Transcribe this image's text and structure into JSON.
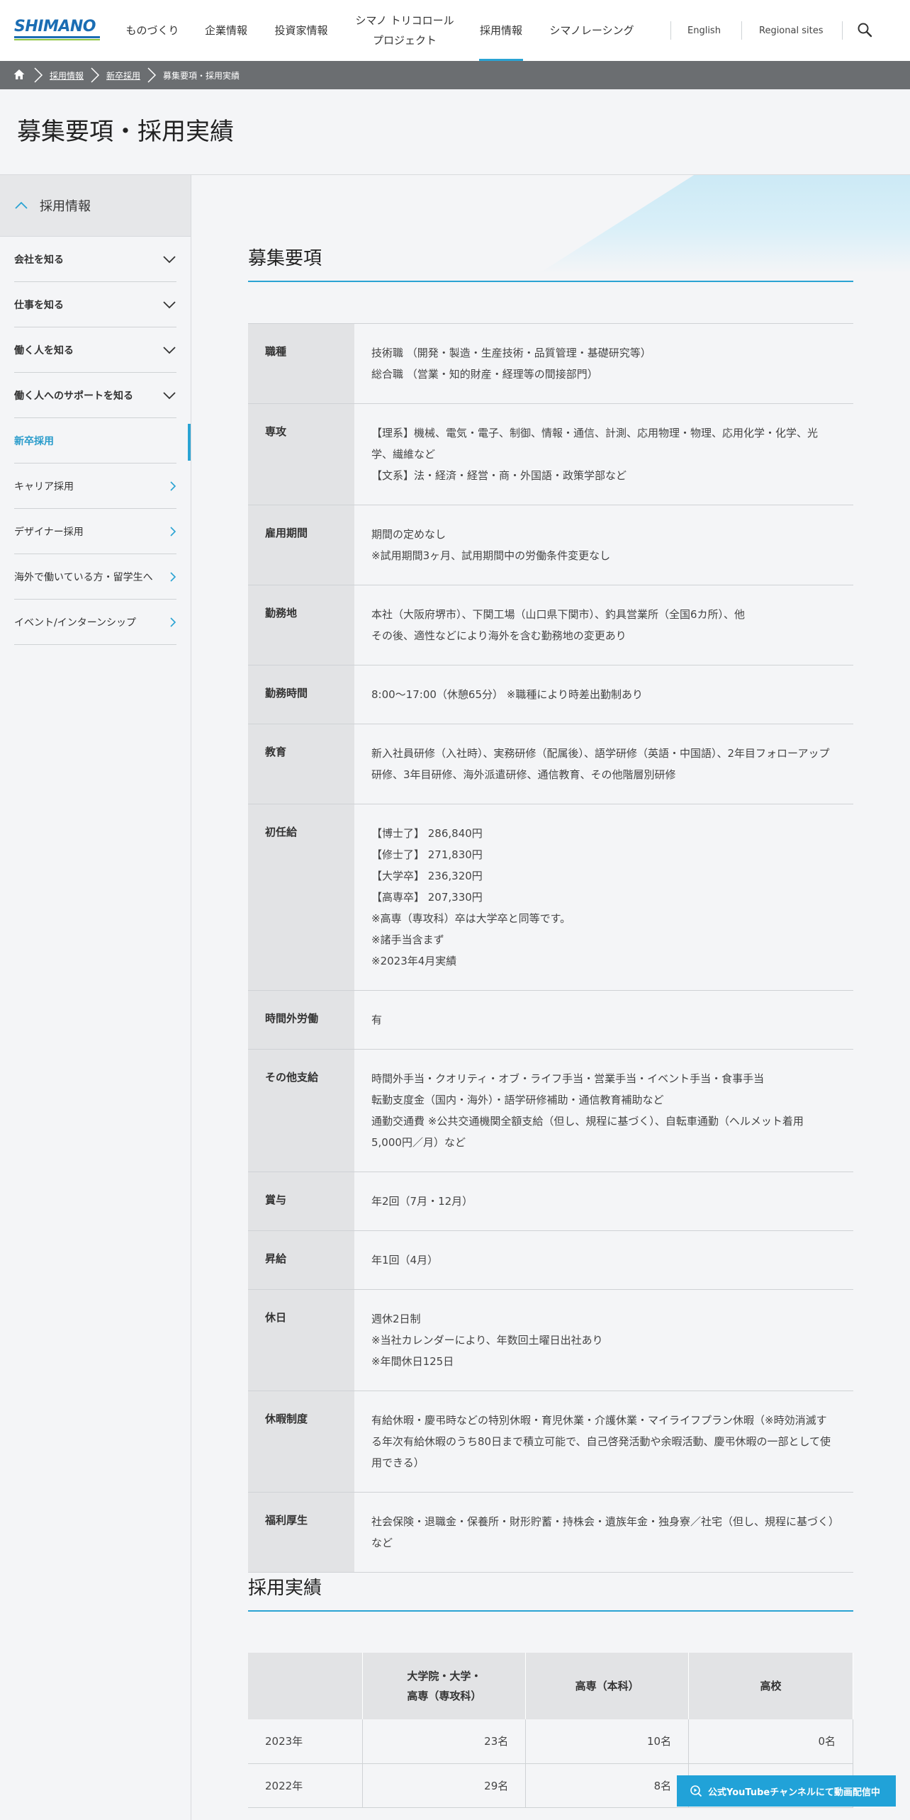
{
  "header": {
    "logo_text": "SHIMANO",
    "nav": [
      {
        "label": "ものづくり"
      },
      {
        "label": "企業情報"
      },
      {
        "label": "投資家情報"
      },
      {
        "label_line1": "シマノ トリコロール",
        "label_line2": "プロジェクト"
      },
      {
        "label": "採用情報"
      },
      {
        "label": "シマノレーシング"
      }
    ],
    "util": {
      "english": "English",
      "regional": "Regional sites"
    }
  },
  "breadcrumb": {
    "items": [
      "採用情報",
      "新卒採用",
      "募集要項・採用実績"
    ]
  },
  "page_title": "募集要項・採用実績",
  "sidebar": {
    "head": "採用情報",
    "items": [
      {
        "label": "会社を知る"
      },
      {
        "label": "仕事を知る"
      },
      {
        "label": "働く人を知る"
      },
      {
        "label": "働く人へのサポートを知る"
      },
      {
        "label": "新卒採用"
      },
      {
        "label": "キャリア採用"
      },
      {
        "label": "デザイナー採用"
      },
      {
        "label": "海外で働いている方・留学生へ"
      },
      {
        "label": "イベント/インターンシップ"
      }
    ]
  },
  "requirements": {
    "title": "募集要項",
    "rows": [
      {
        "key": "職種",
        "lines": [
          "技術職 （開発・製造・生産技術・品質管理・基礎研究等）",
          "総合職 （営業・知的財産・経理等の間接部門）"
        ]
      },
      {
        "key": "専攻",
        "lines": [
          "【理系】機械、電気・電子、制御、情報・通信、計測、応用物理・物理、応用化学・化学、光学、繊維など",
          "【文系】法・経済・経営・商・外国語・政策学部など"
        ]
      },
      {
        "key": "雇用期間",
        "lines": [
          "期間の定めなし",
          "※試用期間3ヶ月、試用期間中の労働条件変更なし"
        ]
      },
      {
        "key": "勤務地",
        "lines": [
          "本社（大阪府堺市）、下関工場（山口県下関市）、釣具営業所（全国6カ所）、他",
          "その後、適性などにより海外を含む勤務地の変更あり"
        ]
      },
      {
        "key": "勤務時間",
        "lines": [
          "8:00～17:00（休憩65分） ※職種により時差出勤制あり"
        ]
      },
      {
        "key": "教育",
        "lines": [
          "新入社員研修（入社時）、実務研修（配属後）、語学研修（英語・中国語）、2年目フォローアップ研修、3年目研修、海外派遣研修、通信教育、その他階層別研修"
        ]
      },
      {
        "key": "初任給",
        "lines": [
          "【博士了】 286,840円",
          "【修士了】 271,830円",
          "【大学卒】 236,320円",
          "【高専卒】 207,330円",
          "※高専（専攻科）卒は大学卒と同等です。",
          "※諸手当含まず",
          "※2023年4月実績"
        ]
      },
      {
        "key": "時間外労働",
        "lines": [
          "有"
        ]
      },
      {
        "key": "その他支給",
        "lines": [
          "時間外手当・クオリティ・オブ・ライフ手当・営業手当・イベント手当・食事手当",
          "転勤支度金（国内・海外）・語学研修補助・通信教育補助など",
          "通勤交通費 ※公共交通機関全額支給（但し、規程に基づく）、自転車通勤（ヘルメット着用 5,000円／月）など"
        ]
      },
      {
        "key": "賞与",
        "lines": [
          "年2回（7月・12月）"
        ]
      },
      {
        "key": "昇給",
        "lines": [
          "年1回（4月）"
        ]
      },
      {
        "key": "休日",
        "lines": [
          "週休2日制",
          "※当社カレンダーにより、年数回土曜日出社あり",
          "※年間休日125日"
        ]
      },
      {
        "key": "休暇制度",
        "lines": [
          "有給休暇・慶弔時などの特別休暇・育児休業・介護休業・マイライフプラン休暇（※時効消滅する年次有給休暇のうち80日まで積立可能で、自己啓発活動や余暇活動、慶弔休暇の一部として使用できる）"
        ]
      },
      {
        "key": "福利厚生",
        "lines": [
          "社会保険・退職金・保養所・財形貯蓄・持株会・遺族年金・独身寮／社宅（但し、規程に基づく）など"
        ]
      }
    ]
  },
  "results": {
    "title": "採用実績",
    "headers": {
      "col1_line1": "大学院・大学・",
      "col1_line2": "高専（専攻科）",
      "col2": "高専（本科）",
      "col3": "高校"
    },
    "rows": [
      {
        "year": "2023年",
        "c1": "23名",
        "c2": "10名",
        "c3": "0名"
      },
      {
        "year": "2022年",
        "c1": "29名",
        "c2": "8名",
        "c3": ""
      }
    ]
  },
  "youtube_button": {
    "label": "公式YouTubeチャンネルにて動画配信中"
  },
  "colors": {
    "accent": "#2aa3d3",
    "brand_blue": "#1b6db3",
    "brand_green": "#8cc43f",
    "breadcrumb_bg": "#6b6e71"
  }
}
